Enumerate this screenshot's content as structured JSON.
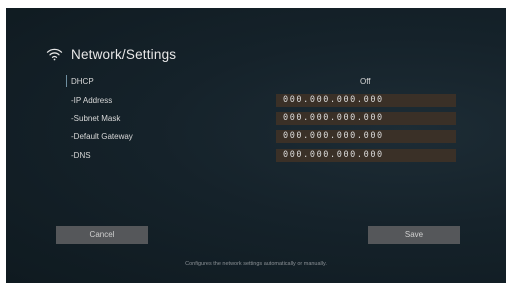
{
  "header": {
    "title": "Network/Settings",
    "icon": "wifi-icon"
  },
  "settings": {
    "dhcp": {
      "label": "DHCP",
      "value": "Off"
    },
    "ip_address": {
      "label": "-IP Address",
      "value": "000.000.000.000"
    },
    "subnet_mask": {
      "label": "-Subnet Mask",
      "value": "000.000.000.000"
    },
    "default_gateway": {
      "label": "-Default Gateway",
      "value": "000.000.000.000"
    },
    "dns": {
      "label": "-DNS",
      "value": "000.000.000.000"
    }
  },
  "buttons": {
    "cancel": "Cancel",
    "save": "Save"
  },
  "help_text": "Configures the network settings automatically or manually.",
  "colors": {
    "background": "#15222a",
    "field_background": "#3a3027",
    "button_background": "#55575a",
    "cursor": "#6f8fa0"
  }
}
